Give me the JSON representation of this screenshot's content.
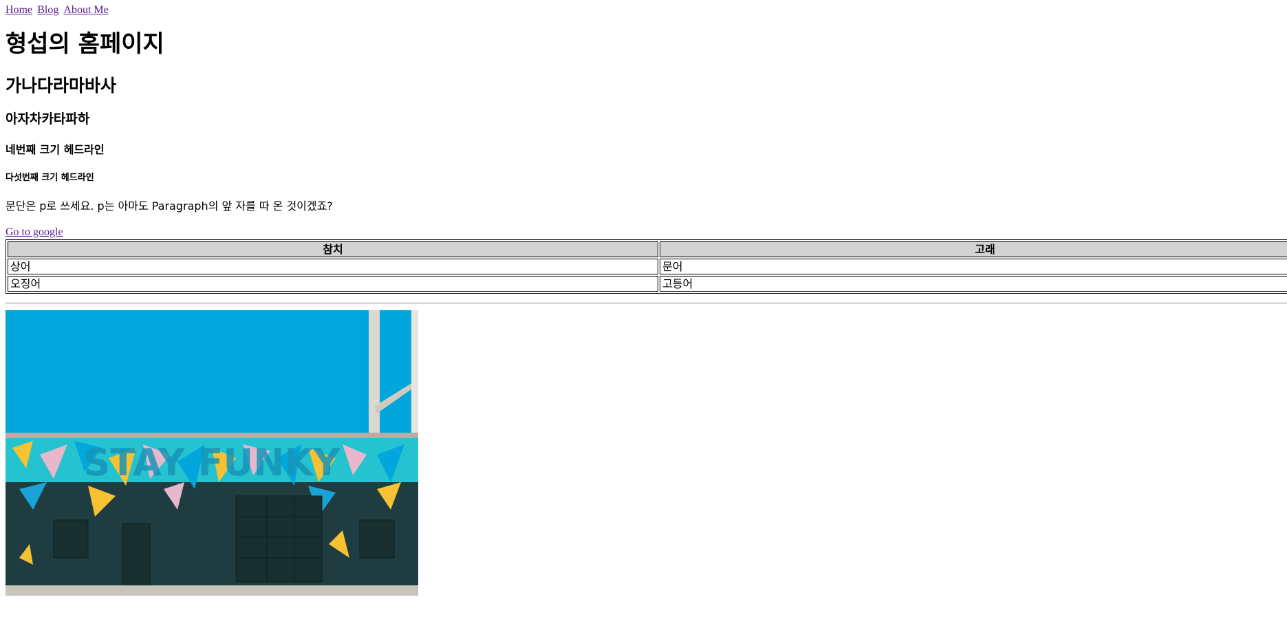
{
  "nav": {
    "home": "Home",
    "blog": "Blog",
    "about": "About Me"
  },
  "headings": {
    "h1": "형섭의 홈페이지",
    "h2": "가나다라마바사",
    "h3": "아자차카타파하",
    "h4": "네번째 크기 헤드라인",
    "h5": "다섯번째 크기 헤드라인"
  },
  "paragraph": "문단은 p로 쓰세요. p는 아마도 Paragraph의 앞 자를 따 온 것이겠죠?",
  "google_link": "Go to google",
  "table": {
    "headers": [
      "참치",
      "고래"
    ],
    "rows": [
      [
        "상어",
        "문어"
      ],
      [
        "오징어",
        "고등어"
      ]
    ]
  },
  "image": {
    "wall_text": "STAY FUNKY"
  },
  "colors": {
    "link_visited": "#551a8b",
    "table_header_bg": "#d3d3d3",
    "sky": "#00a6dc",
    "wall": "#1f3d40"
  }
}
